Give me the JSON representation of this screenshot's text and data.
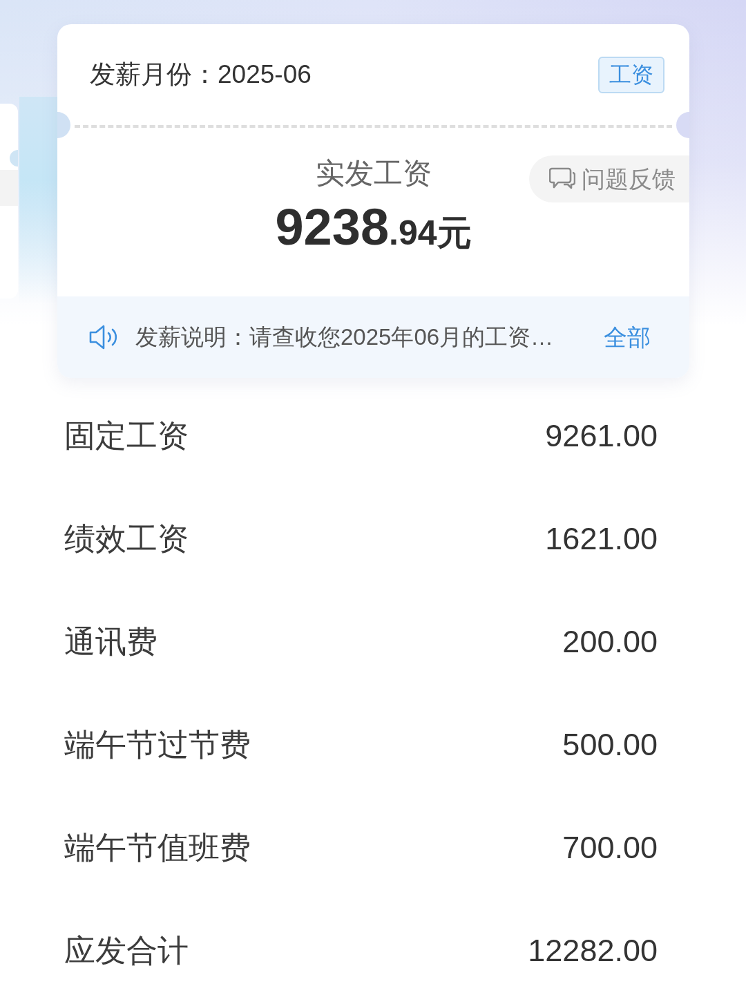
{
  "payslip": {
    "month": "发薪月份：2025-06",
    "tag": "工资"
  },
  "net_pay": {
    "label": "实发工资",
    "amount_whole": "9238",
    "amount_fraction": ".94",
    "unit": "元"
  },
  "feedback_button": {
    "label": "问题反馈"
  },
  "notice": {
    "text": "发薪说明：请查收您2025年06月的工资…",
    "link": "全部"
  },
  "items": [
    {
      "label": "固定工资",
      "value": "9261.00"
    },
    {
      "label": "绩效工资",
      "value": "1621.00"
    },
    {
      "label": "通讯费",
      "value": "200.00"
    },
    {
      "label": "端午节过节费",
      "value": "500.00"
    },
    {
      "label": "端午节值班费",
      "value": "700.00"
    },
    {
      "label": "应发合计",
      "value": "12282.00"
    }
  ]
}
